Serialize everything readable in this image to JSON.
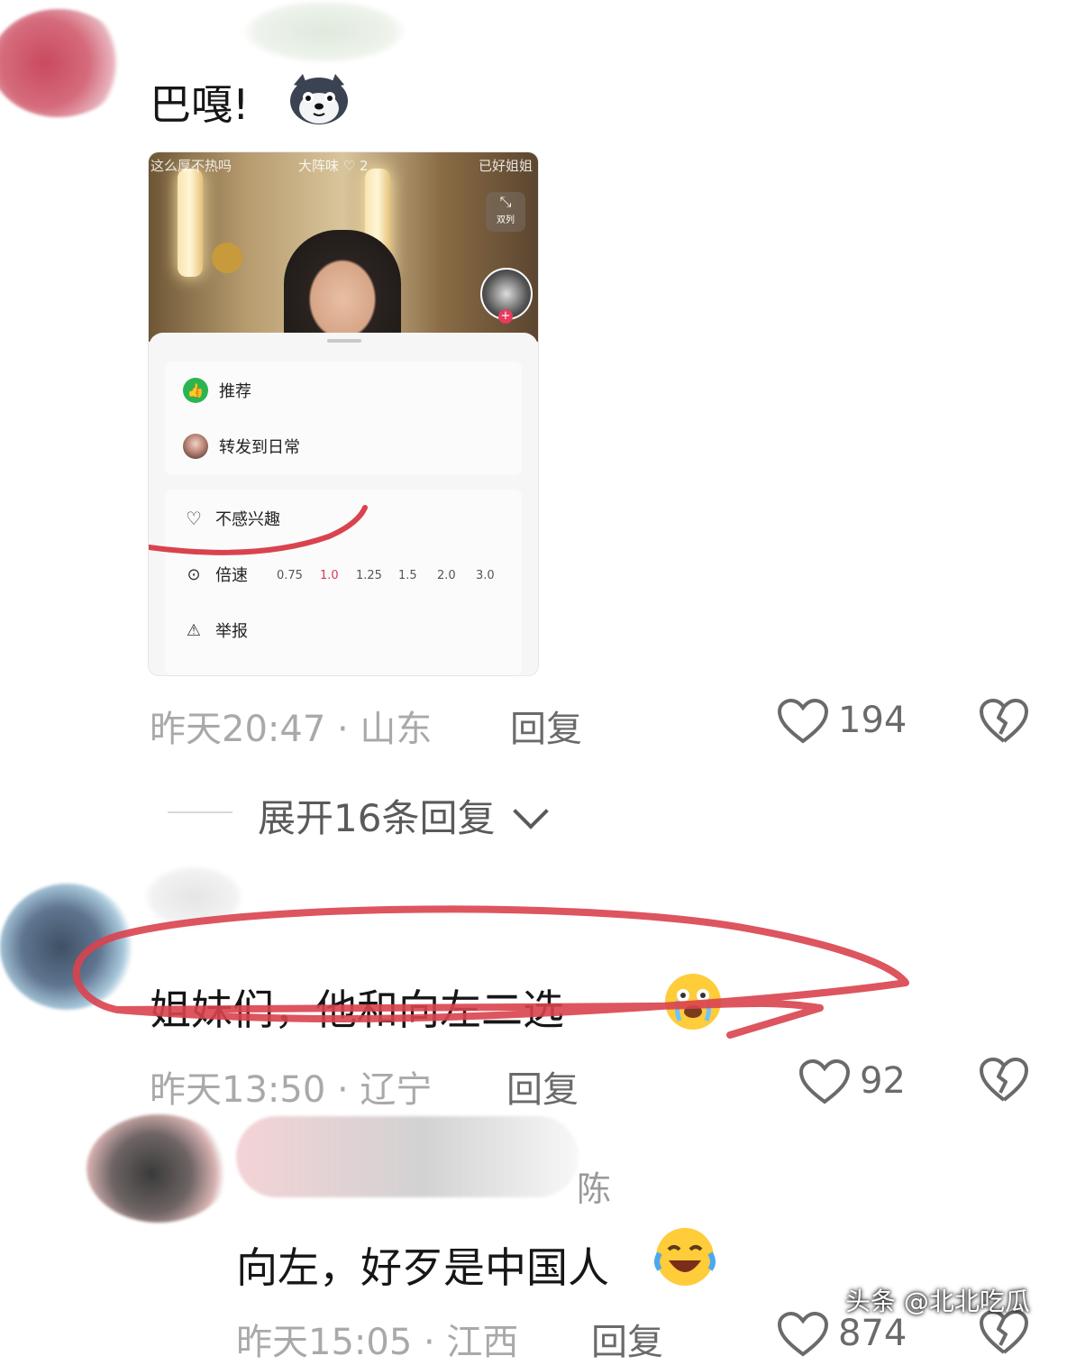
{
  "comment1": {
    "text": "巴嘎!",
    "emoji_icon": "husky-dog-icon",
    "meta": "昨天20:47 · 山东",
    "reply_label": "回复",
    "likes": "194"
  },
  "screenshot": {
    "overlay_texts": [
      "这么厚不热吗",
      "大阵味 ♡ 2",
      "已好姐姐"
    ],
    "side_button_label": "双列",
    "menu": {
      "recommend": "推荐",
      "forward": "转发到日常",
      "not_interested": "不感兴趣",
      "speed_label": "倍速",
      "speeds": [
        "0.75",
        "1.0",
        "1.25",
        "1.5",
        "2.0",
        "3.0"
      ],
      "selected_speed": "1.0",
      "report": "举报"
    }
  },
  "expand_replies": "展开16条回复",
  "comment2": {
    "text": "姐妹们，他和向左二选",
    "emoji_icon": "crying-face-icon",
    "meta": "昨天13:50 · 辽宁",
    "reply_label": "回复",
    "likes": "92"
  },
  "comment3": {
    "author": "陈",
    "text": "向左，好歹是中国人",
    "emoji_icon": "laughing-tears-icon",
    "meta": "昨天15:05 · 江西",
    "reply_label": "回复",
    "likes": "874"
  },
  "watermark": "头条 @北北吃瓜",
  "colors": {
    "annotation_red": "#d9434e",
    "recommend_green": "#2bb552",
    "speed_selected": "#d23b5b"
  }
}
